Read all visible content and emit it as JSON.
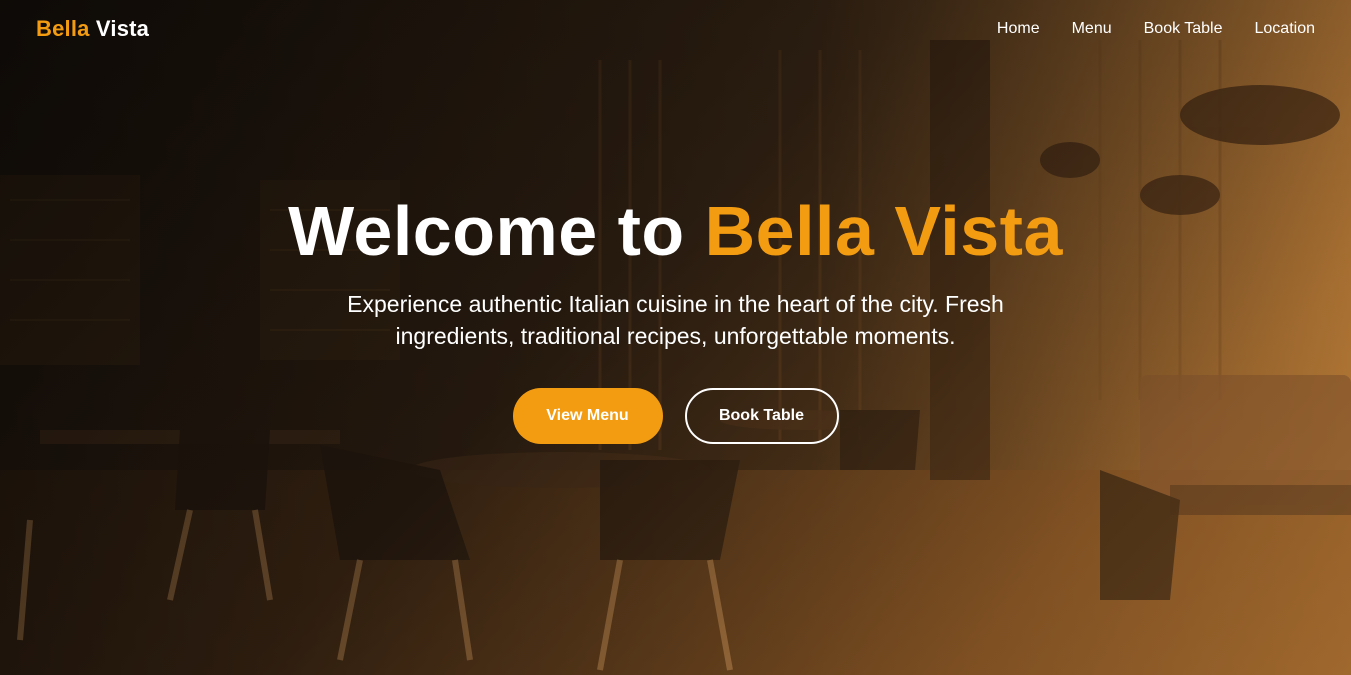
{
  "brand": {
    "accent": "Bella",
    "main": "Vista"
  },
  "nav": {
    "items": [
      {
        "label": "Home"
      },
      {
        "label": "Menu"
      },
      {
        "label": "Book Table"
      },
      {
        "label": "Location"
      }
    ]
  },
  "hero": {
    "title_prefix": "Welcome to ",
    "title_accent": "Bella Vista",
    "subtitle": "Experience authentic Italian cuisine in the heart of the city. Fresh ingredients, traditional recipes, unforgettable moments.",
    "primary_button": "View Menu",
    "secondary_button": "Book Table"
  },
  "colors": {
    "accent": "#f39c12",
    "text": "#ffffff"
  },
  "icons": []
}
